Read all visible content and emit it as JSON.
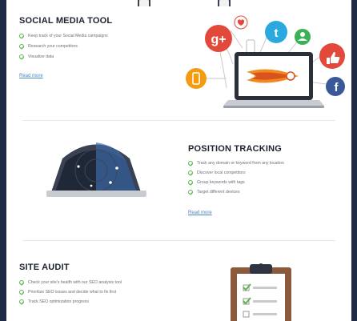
{
  "sections": [
    {
      "title": "SOCIAL MEDIA TOOL",
      "bullets": [
        "Keep track of your Social Media campaigns",
        "Research your competitors",
        "Visualize data"
      ],
      "read_more": "Read more"
    },
    {
      "title": "POSITION TRACKING",
      "bullets": [
        "Track any domain or keyword from any location",
        "Discover local competitors",
        "Group keywords with tags",
        "Target different devices"
      ],
      "read_more": "Read more"
    },
    {
      "title": "SITE AUDIT",
      "bullets": [
        "Check your site's health with our SEO analysis tool",
        "Prioritize SEO issues and decide what to fix first",
        "Track SEO optimization progress"
      ]
    }
  ],
  "icons": {
    "google_plus": "g+",
    "twitter": "t",
    "facebook": "f",
    "like": "thumbs-up-icon",
    "heart": "heart-icon",
    "phone": "phone-icon",
    "user": "user-icon"
  },
  "colors": {
    "accent_check": "#58b84a",
    "link": "#4a86c5",
    "google_plus": "#e2493b",
    "twitter": "#2aa9e0",
    "facebook": "#3b5998",
    "like": "#e2493b",
    "phone": "#f39c12",
    "user": "#3cb054",
    "heart": "#e2493b"
  }
}
